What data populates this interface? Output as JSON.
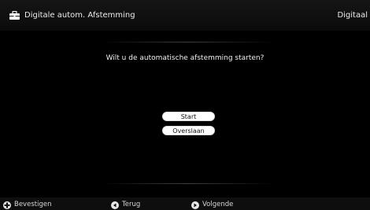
{
  "header": {
    "title": "Digitale autom. Afstemming",
    "right_label": "Digitaal",
    "icon": "toolbox-icon"
  },
  "dialog": {
    "question": "Wilt u de automatische afstemming starten?",
    "buttons": {
      "start": "Start",
      "skip": "Overslaan"
    }
  },
  "footer": {
    "confirm": {
      "icon": "dpad-icon",
      "label": "Bevestigen"
    },
    "back": {
      "icon": "left-arrow-circle-icon",
      "label": "Terug"
    },
    "next": {
      "icon": "right-arrow-circle-icon",
      "label": "Volgende"
    }
  },
  "colors": {
    "background": "#000000",
    "button": "#ffffff",
    "text": "#ececec"
  }
}
